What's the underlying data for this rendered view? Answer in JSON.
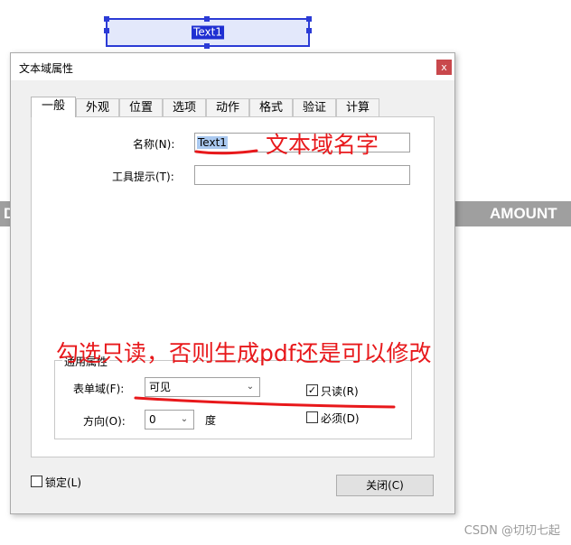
{
  "background": {
    "field_label": "Text1",
    "band_left_text": "D",
    "band_right_text": "AMOUNT",
    "watermark": "CSDN @切切七起"
  },
  "dialog": {
    "title": "文本域属性",
    "close_glyph": "x",
    "tabs": [
      {
        "label": "一般",
        "active": true
      },
      {
        "label": "外观"
      },
      {
        "label": "位置"
      },
      {
        "label": "选项"
      },
      {
        "label": "动作"
      },
      {
        "label": "格式"
      },
      {
        "label": "验证"
      },
      {
        "label": "计算"
      }
    ],
    "name_label": "名称(N):",
    "name_value": "Text1",
    "tooltip_label": "工具提示(T):",
    "tooltip_value": "",
    "group_title": "通用属性",
    "form_field_label": "表单域(F):",
    "form_field_value": "可见",
    "readonly_label": "只读(R)",
    "readonly_checked": true,
    "required_label": "必须(D)",
    "required_checked": false,
    "direction_label": "方向(O):",
    "direction_value": "0",
    "direction_unit": "度",
    "locked_label": "锁定(L)",
    "locked_checked": false,
    "close_button": "关闭(C)"
  },
  "annotations": {
    "name_note": "文本域名字",
    "readonly_note": "勾选只读，否则生成pdf还是可以修改"
  },
  "colors": {
    "annotation": "#e8181b",
    "selection": "#2b3bd6"
  }
}
